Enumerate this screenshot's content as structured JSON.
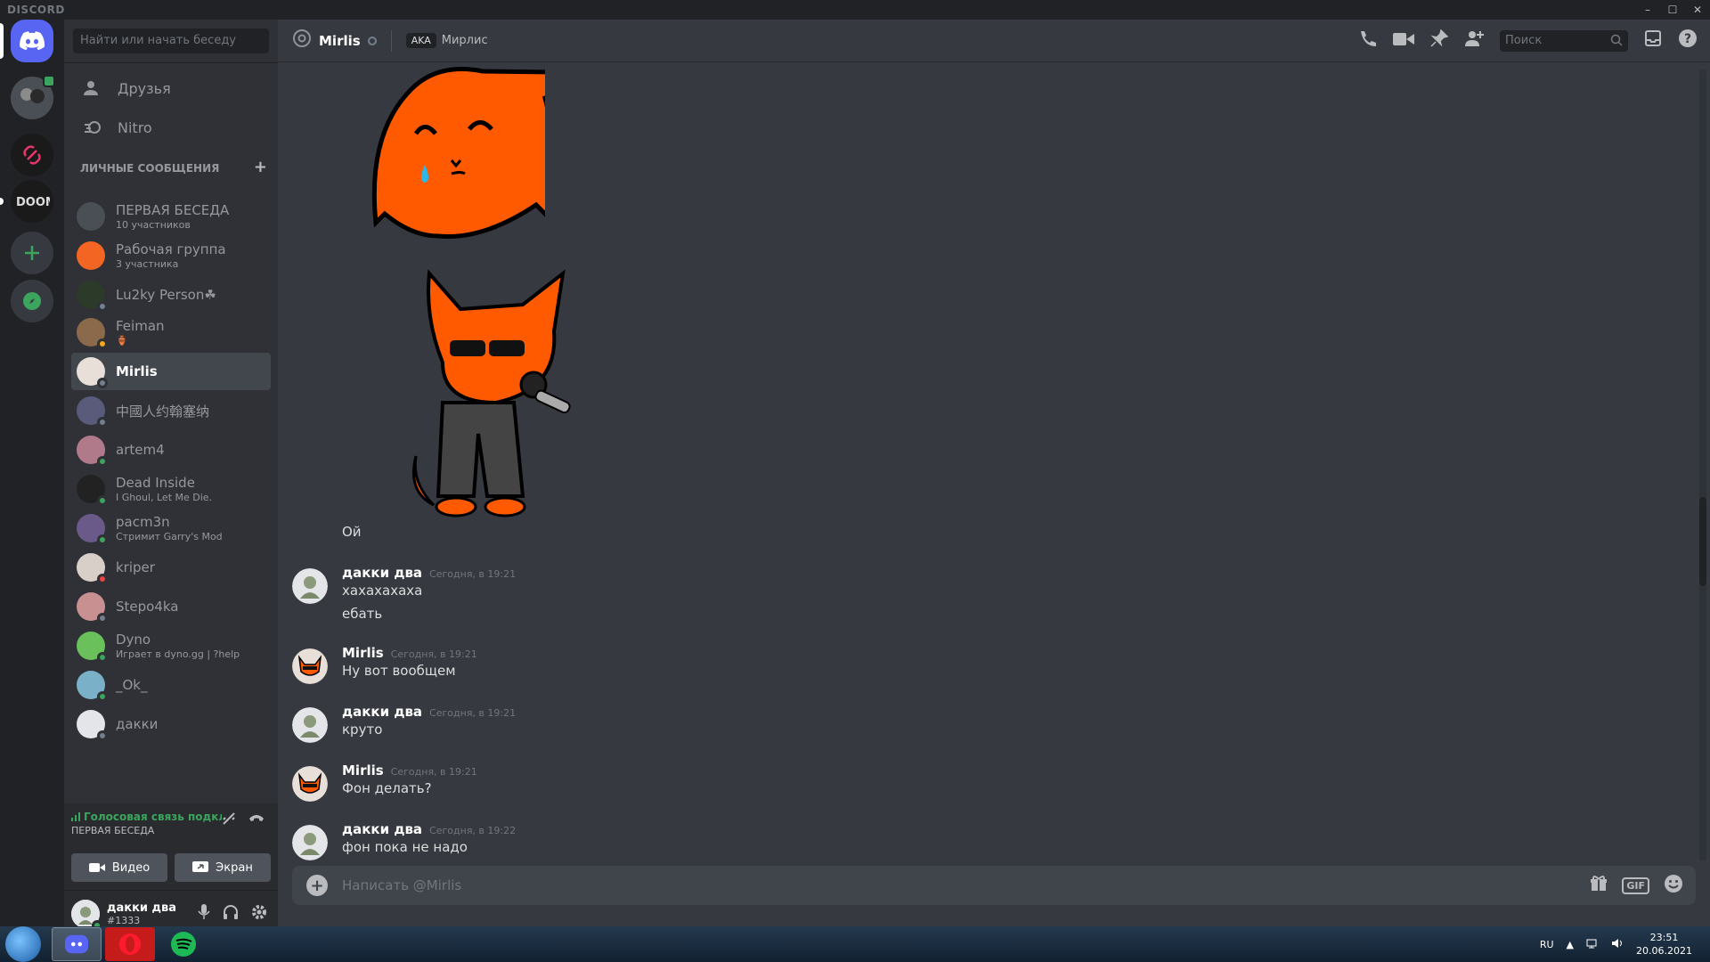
{
  "window": {
    "brand": "DISCORD",
    "min": "–",
    "max": "☐",
    "close": "✕"
  },
  "sidebar": {
    "search_placeholder": "Найти или начать беседу",
    "nav": [
      {
        "label": "Друзья",
        "icon": "friends-icon"
      },
      {
        "label": "Nitro",
        "icon": "nitro-icon"
      }
    ],
    "dm_header": "ЛИЧНЫЕ СООБЩЕНИЯ",
    "dm_header_add": "+",
    "dms": [
      {
        "name": "ПЕРВАЯ БЕСЕДА",
        "sub": "10 участников",
        "color": "#4a4f55",
        "status": ""
      },
      {
        "name": "Рабочая группа",
        "sub": "3 участника",
        "color": "#f26522",
        "status": ""
      },
      {
        "name": "Lu2ky Person☘",
        "sub": "",
        "color": "#2c3a2a",
        "status": "#747f8d"
      },
      {
        "name": "Feiman",
        "sub": "🏺",
        "color": "#8a6a4a",
        "status": "#faa81a"
      },
      {
        "name": "Mirlis",
        "sub": "",
        "color": "#e8e0d8",
        "status": "#747f8d"
      },
      {
        "name": "中國人约翰塞纳",
        "sub": "",
        "color": "#5a5a7a",
        "status": "#747f8d"
      },
      {
        "name": "artem4",
        "sub": "",
        "color": "#b07a8a",
        "status": "#3ba55d"
      },
      {
        "name": "Dead Inside",
        "sub": "I Ghoul, Let Me Die.",
        "color": "#222222",
        "status": "#3ba55d"
      },
      {
        "name": "pacm3n",
        "sub": "Стримит Garry's Mod",
        "color": "#6a5a8a",
        "status": "#3ba55d"
      },
      {
        "name": "kriper",
        "sub": "",
        "color": "#d8d0c8",
        "status": "#ed4245"
      },
      {
        "name": "Stepo4ka",
        "sub": "",
        "color": "#c89090",
        "status": "#747f8d"
      },
      {
        "name": "Dyno",
        "sub": "Играет в dyno.gg | ?help",
        "color": "#6ac05a",
        "status": "#3ba55d"
      },
      {
        "name": "_Ok_",
        "sub": "",
        "color": "#7ab0c8",
        "status": "#3ba55d"
      },
      {
        "name": "дакки",
        "sub": "",
        "color": "#e3e5e8",
        "status": "#747f8d"
      }
    ],
    "voice": {
      "status": "Голосовая связь подключена",
      "channel": "ПЕРВАЯ БЕСЕДА",
      "video_label": "Видео",
      "screen_label": "Экран"
    },
    "user": {
      "name": "дакки два",
      "tag": "#1333"
    }
  },
  "header": {
    "name": "Mirlis",
    "aka_badge": "AKA",
    "aka_name": "Мирлис",
    "search_placeholder": "Поиск"
  },
  "chat": {
    "preceding_text": "Ой",
    "messages": [
      {
        "author": "дакки два",
        "time": "Сегодня, в 19:21",
        "lines": [
          "хахахахаха",
          "ебать"
        ]
      },
      {
        "author": "Mirlis",
        "time": "Сегодня, в 19:21",
        "lines": [
          "Ну вот вообщем"
        ]
      },
      {
        "author": "дакки два",
        "time": "Сегодня, в 19:21",
        "lines": [
          "круто"
        ]
      },
      {
        "author": "Mirlis",
        "time": "Сегодня, в 19:21",
        "lines": [
          "Фон делать?"
        ]
      },
      {
        "author": "дакки два",
        "time": "Сегодня, в 19:22",
        "lines": [
          "фон пока не надо"
        ]
      }
    ],
    "composer_placeholder": "Написать @Mirlis",
    "gif_label": "GIF"
  },
  "taskbar": {
    "lang": "RU",
    "time": "23:51",
    "date": "20.06.2021"
  },
  "colors": {
    "accent": "#5865f2",
    "online": "#3ba55d",
    "dnd": "#ed4245",
    "idle": "#faa81a",
    "fox": "#ff5a00"
  }
}
